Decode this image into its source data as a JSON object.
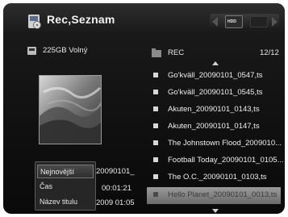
{
  "header": {
    "title": "Rec,Seznam",
    "nav_chip_label": "HDD"
  },
  "storage": {
    "label": "225GB Volný"
  },
  "preview": {
    "date_fragment": "20090101_",
    "time": "00:01:21",
    "datetime_fragment": "2009  01:05"
  },
  "sort_menu": {
    "items": [
      "Nejnovější",
      "Čas",
      "Název titulu"
    ],
    "selected_index": 0
  },
  "folder": {
    "name": "REC",
    "page": "12/12"
  },
  "files": [
    "Go'kväll_20090101_0547,ts",
    "Go'kväll_20090101_0545,ts",
    "Akuten_20090101_0143,ts",
    "Akuten_20090101_0147,ts",
    "The Johnstown Flood_2009010...",
    "Football Today_20090101_0105...",
    "The O.C._20090101_0103,ts",
    "Hello Planet_20090101_0013,ts"
  ],
  "highlighted_file_index": 7
}
